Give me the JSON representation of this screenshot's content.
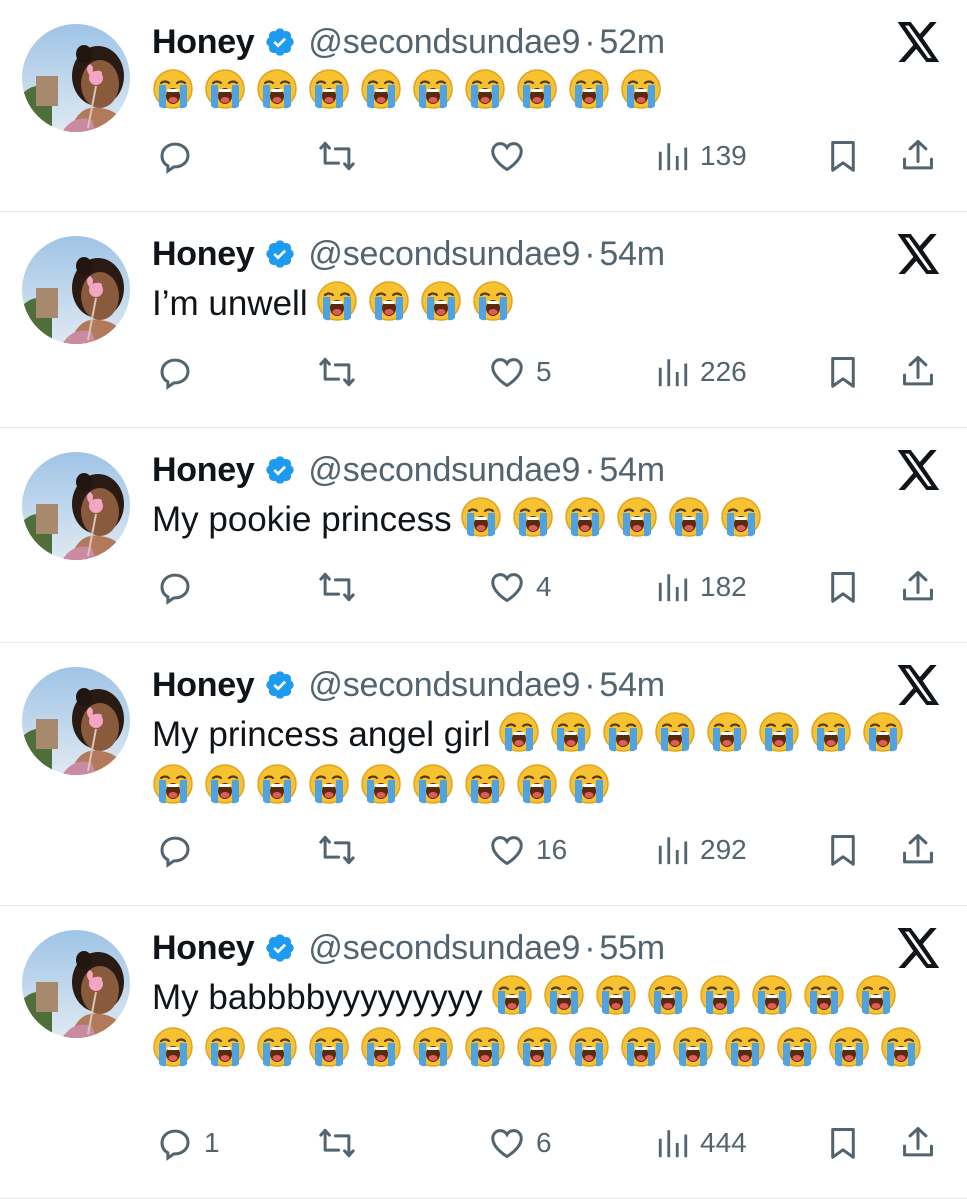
{
  "tweets": [
    {
      "name": "Honey",
      "handle": "@secondsundae9",
      "separator": "·",
      "time": "52m",
      "text": "",
      "emoji_count": 10,
      "emoji": "loudly-crying-face",
      "replies": "",
      "likes": "",
      "views": "139"
    },
    {
      "name": "Honey",
      "handle": "@secondsundae9",
      "separator": "·",
      "time": "54m",
      "text": "I’m unwell",
      "emoji_count": 4,
      "emoji": "loudly-crying-face",
      "replies": "",
      "likes": "5",
      "views": "226"
    },
    {
      "name": "Honey",
      "handle": "@secondsundae9",
      "separator": "·",
      "time": "54m",
      "text": "My pookie princess",
      "emoji_count": 6,
      "emoji": "loudly-crying-face",
      "replies": "",
      "likes": "4",
      "views": "182"
    },
    {
      "name": "Honey",
      "handle": "@secondsundae9",
      "separator": "·",
      "time": "54m",
      "text": "My princess angel girl",
      "emoji_count": 17,
      "emoji": "loudly-crying-face",
      "replies": "",
      "likes": "16",
      "views": "292"
    },
    {
      "name": "Honey",
      "handle": "@secondsundae9",
      "separator": "·",
      "time": "55m",
      "text": "My babbbbyyyyyyyyy",
      "emoji_count": 23,
      "emoji": "loudly-crying-face",
      "replies": "1",
      "likes": "6",
      "views": "444"
    }
  ],
  "icons": {
    "verified": "verified-badge-icon",
    "platform": "x-logo-icon",
    "reply": "reply-icon",
    "retweet": "retweet-icon",
    "like": "heart-icon",
    "views": "views-icon",
    "bookmark": "bookmark-icon",
    "share": "share-icon"
  },
  "colors": {
    "text": "#0f1419",
    "secondary": "#536471",
    "verified": "#1d9bf0",
    "divider": "#e6e9ec"
  }
}
